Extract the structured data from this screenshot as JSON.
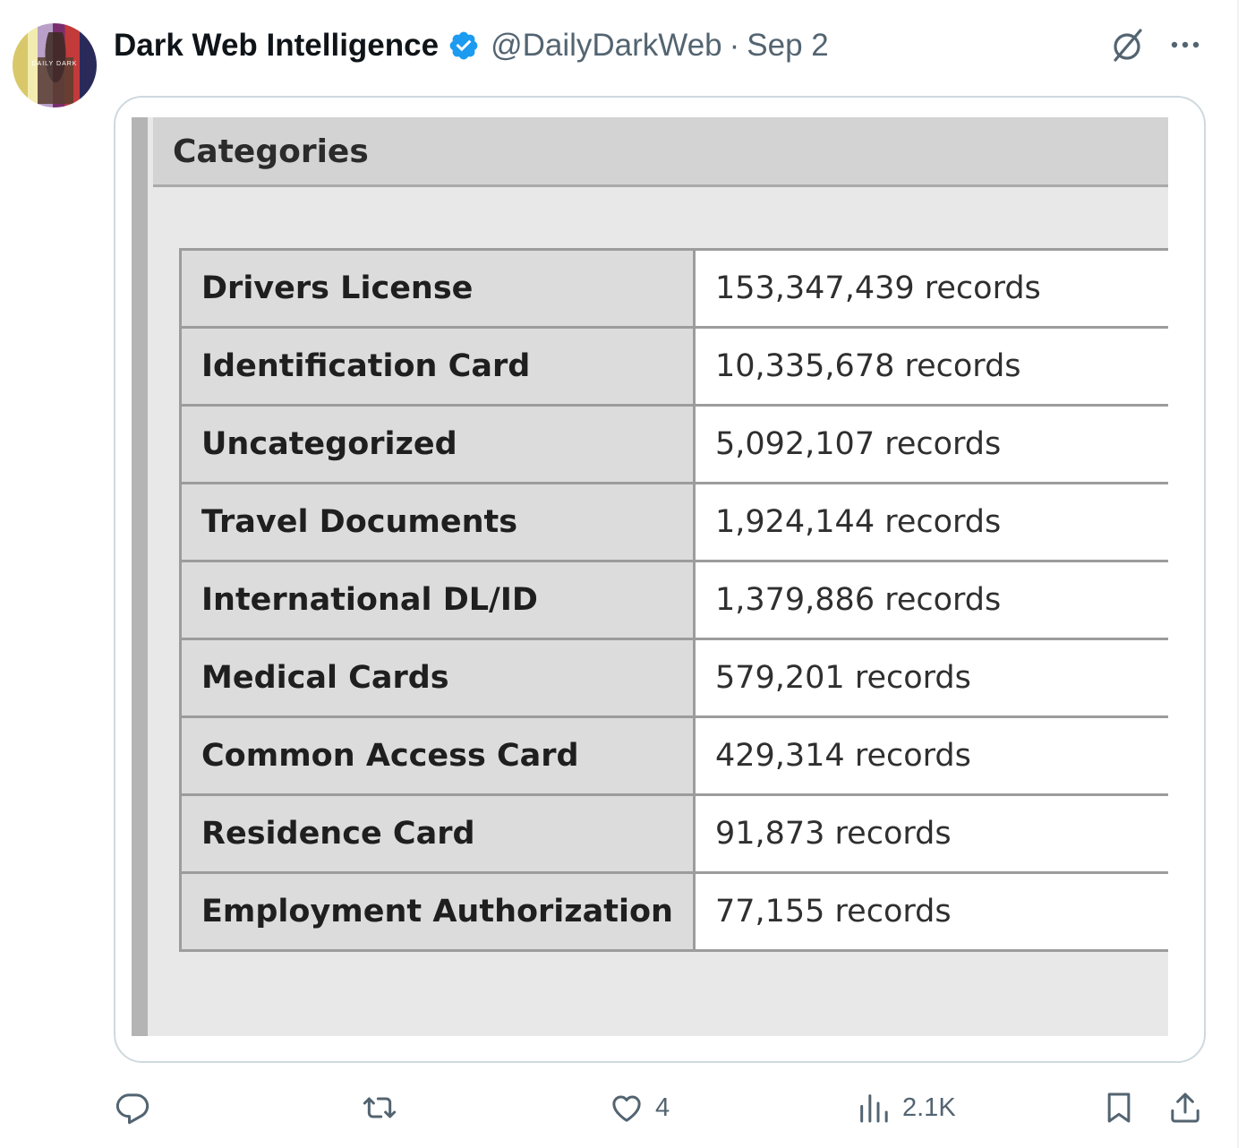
{
  "tweet": {
    "author": {
      "display_name": "Dark Web Intelligence",
      "verified": true,
      "handle": "@DailyDarkWeb",
      "separator": "·",
      "date": "Sep 2",
      "avatar_icon": "avatar-image"
    },
    "media": {
      "panel_title": "Categories",
      "rows": [
        {
          "category": "Drivers License",
          "records": "153,347,439 records"
        },
        {
          "category": "Identification Card",
          "records": "10,335,678 records"
        },
        {
          "category": "Uncategorized",
          "records": "5,092,107 records"
        },
        {
          "category": "Travel Documents",
          "records": "1,924,144 records"
        },
        {
          "category": "International DL/ID",
          "records": "1,379,886 records"
        },
        {
          "category": "Medical Cards",
          "records": "579,201 records"
        },
        {
          "category": "Common Access Card",
          "records": "429,314 records"
        },
        {
          "category": "Residence Card",
          "records": "91,873 records"
        },
        {
          "category": "Employment Authorization",
          "records": "77,155 records"
        }
      ]
    },
    "actions": {
      "reply_count": "",
      "retweet_count": "",
      "like_count": "4",
      "views_count": "2.1K"
    }
  },
  "colors": {
    "text_primary": "#0f1419",
    "text_secondary": "#536471",
    "verified_blue": "#1d9bf0",
    "card_border": "#cfd9de"
  },
  "icons": [
    "verified-badge-icon",
    "grok-icon",
    "more-icon",
    "reply-icon",
    "retweet-icon",
    "like-icon",
    "views-icon",
    "bookmark-icon",
    "share-icon"
  ]
}
